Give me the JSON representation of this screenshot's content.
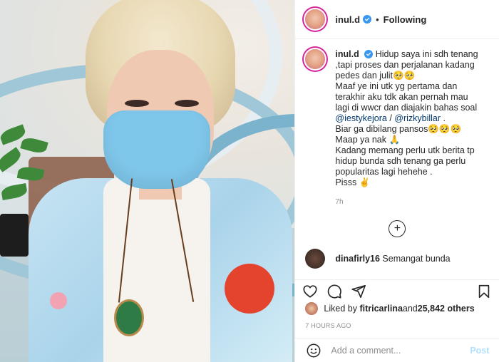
{
  "header": {
    "username": "inul.d",
    "dot": "•",
    "follow_state": "Following",
    "verified_icon": "verified-badge-icon"
  },
  "caption": {
    "username": "inul.d",
    "lines": [
      "Hidup saya ini sdh tenang",
      ",tapi proses dan perjalanan kadang",
      "pedes dan julit🥺🥺",
      "Maaf ye ini utk yg pertama dan",
      "terakhir aku tdk akan pernah mau",
      "lagi di wwcr dan diajakin bahas soal",
      "Biar ga dibilang pansos🥺🥺🥺",
      "Maap ya nak 🙏",
      "Kadang memang perlu utk berita tp",
      "hidup bunda sdh tenang ga perlu",
      "popularitas lagi hehehe .",
      "Pisss ✌"
    ],
    "mention1": "@iestykejora",
    "separator": " / ",
    "mention2": "@rizkybillar",
    "mention_tail": " .",
    "time": "7h"
  },
  "load_more_icon": "plus-circle-icon",
  "next_comment": {
    "username": "dinafirly16",
    "text": "Semangat bunda"
  },
  "actions": {
    "like_icon": "heart-icon",
    "comment_icon": "comment-icon",
    "share_icon": "paper-plane-icon",
    "save_icon": "bookmark-icon"
  },
  "likes": {
    "prefix": "Liked by ",
    "user": "fitricarlina",
    "middle": " and ",
    "count": "25,842 others"
  },
  "posted": "7 HOURS AGO",
  "add_comment": {
    "placeholder": "Add a comment...",
    "post_label": "Post",
    "emoji_icon": "smiley-icon"
  },
  "colors": {
    "verified": "#3897f0",
    "link": "#00376b",
    "post_disabled": "#b2dffc",
    "secondary_text": "#8e8e8e"
  }
}
